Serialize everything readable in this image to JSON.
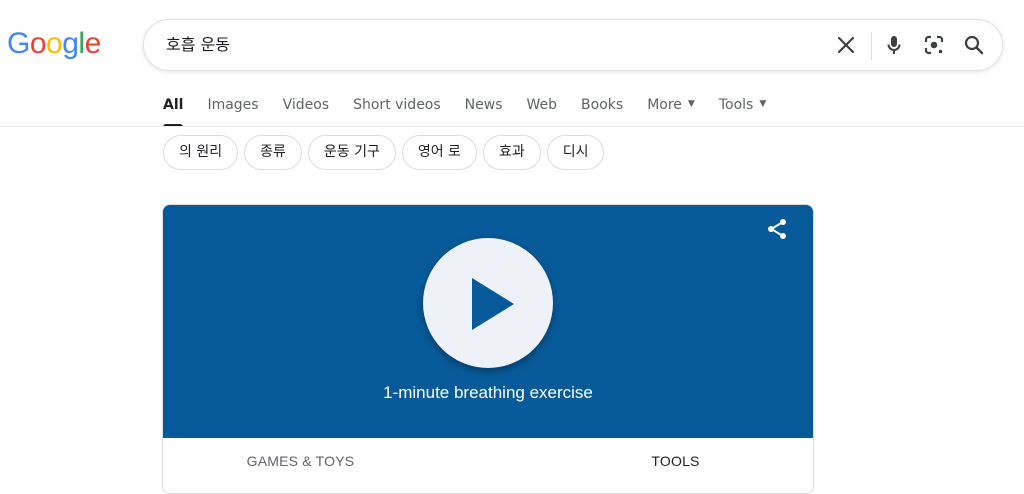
{
  "logo": {
    "letters": [
      {
        "char": "G",
        "color": "#4285F4"
      },
      {
        "char": "o",
        "color": "#EA4335"
      },
      {
        "char": "o",
        "color": "#FBBC05"
      },
      {
        "char": "g",
        "color": "#4285F4"
      },
      {
        "char": "l",
        "color": "#34A853"
      },
      {
        "char": "e",
        "color": "#EA4335"
      }
    ]
  },
  "search": {
    "query": "호흡 운동",
    "icons": [
      "close-icon",
      "mic-icon",
      "lens-icon",
      "search-icon"
    ]
  },
  "tabs": [
    {
      "label": "All",
      "active": true
    },
    {
      "label": "Images"
    },
    {
      "label": "Videos"
    },
    {
      "label": "Short videos"
    },
    {
      "label": "News"
    },
    {
      "label": "Web"
    },
    {
      "label": "Books"
    },
    {
      "label": "More",
      "dropdown": true
    },
    {
      "label": "Tools",
      "dropdown": true
    }
  ],
  "chips": [
    "의 원리",
    "종류",
    "운동 기구",
    "영어 로",
    "효과",
    "디시"
  ],
  "card": {
    "hero_color": "#075a99",
    "title": "1-minute breathing exercise",
    "tabs": [
      "GAMES & TOYS",
      "TOOLS"
    ]
  }
}
